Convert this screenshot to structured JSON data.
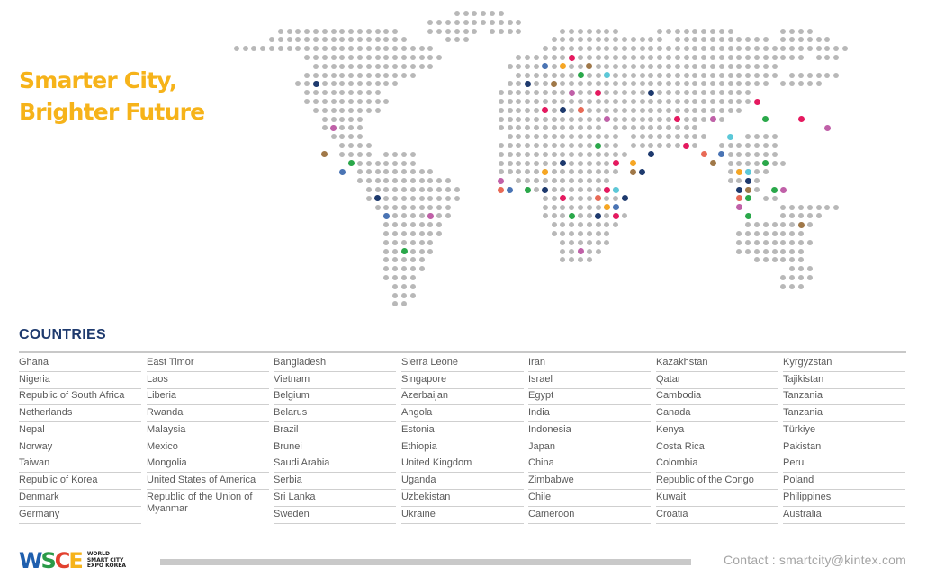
{
  "headline": {
    "line1": "Smarter City,",
    "line2": "Brighter Future"
  },
  "section_title": "COUNTRIES",
  "countries_columns": [
    [
      "Ghana",
      "Nigeria",
      "Republic of South Africa",
      "Netherlands",
      "Nepal",
      "Norway",
      "Taiwan",
      "Republic of Korea",
      "Denmark",
      "Germany"
    ],
    [
      "East Timor",
      "Laos",
      "Liberia",
      "Rwanda",
      "Malaysia",
      "Mexico",
      "Mongolia",
      "United States of America",
      "Republic of the Union of Myanmar"
    ],
    [
      "Bangladesh",
      "Vietnam",
      "Belgium",
      "Belarus",
      "Brazil",
      "Brunei",
      "Saudi Arabia",
      "Serbia",
      "Sri Lanka",
      "Sweden"
    ],
    [
      "Sierra Leone",
      "Singapore",
      "Azerbaijan",
      "Angola",
      "Estonia",
      "Ethiopia",
      "United Kingdom",
      "Uganda",
      "Uzbekistan",
      "Ukraine"
    ],
    [
      "Iran",
      "Israel",
      "Egypt",
      "India",
      "Indonesia",
      "Japan",
      "China",
      "Zimbabwe",
      "Chile",
      "Cameroon"
    ],
    [
      "Kazakhstan",
      "Qatar",
      "Cambodia",
      "Canada",
      "Kenya",
      "Costa Rica",
      "Colombia",
      "Republic of the Congo",
      "Kuwait",
      "Croatia"
    ],
    [
      "Kyrgyzstan",
      "Tajikistan",
      "Tanzania",
      "Tanzania",
      "Türkiye",
      "Pakistan",
      "Peru",
      "Poland",
      "Philippines",
      "Australia"
    ]
  ],
  "footer": {
    "logo_letters": [
      "W",
      "S",
      "C",
      "E"
    ],
    "logo_colors": [
      "#1f5fae",
      "#2a9a48",
      "#e2412f",
      "#f6b31a"
    ],
    "logo_sub_lines": [
      "WORLD",
      "SMART CITY",
      "EXPO KOREA"
    ],
    "contact": "Contact : smartcity@kintex.com"
  },
  "colors": {
    "headline": "#F6B31A",
    "section_title": "#1e3a6e",
    "map_dot": "#b8b8b8",
    "map_markers": [
      "#e5195f",
      "#1e3a6e",
      "#f6a623",
      "#2aa84a",
      "#4a74b4",
      "#c060a8",
      "#a07848",
      "#e86a56",
      "#5bc8d8"
    ]
  }
}
